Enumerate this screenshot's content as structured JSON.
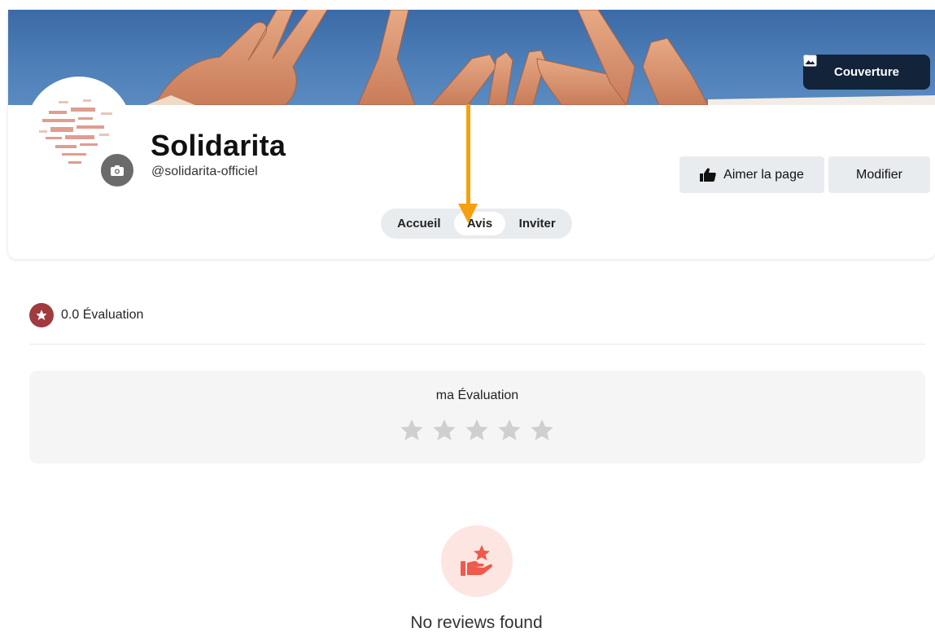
{
  "cover": {
    "button_label": "Couverture"
  },
  "profile": {
    "name": "Solidarita",
    "handle": "@solidarita-officiel",
    "like_label": "Aimer la page",
    "edit_label": "Modifier"
  },
  "tabs": [
    {
      "label": "Accueil",
      "active": false
    },
    {
      "label": "Avis",
      "active": true
    },
    {
      "label": "Inviter",
      "active": false
    }
  ],
  "reviews": {
    "summary": "0.0 Évaluation",
    "my_rating_label": "ma Évaluation",
    "my_rating_value": 0,
    "max_stars": 5,
    "empty_message": "No reviews found"
  },
  "colors": {
    "cover_button_bg": "#13233a",
    "accent_arrow": "#f5a00f",
    "rating_badge": "#a13a3f",
    "empty_icon": "#ee5a4b"
  }
}
